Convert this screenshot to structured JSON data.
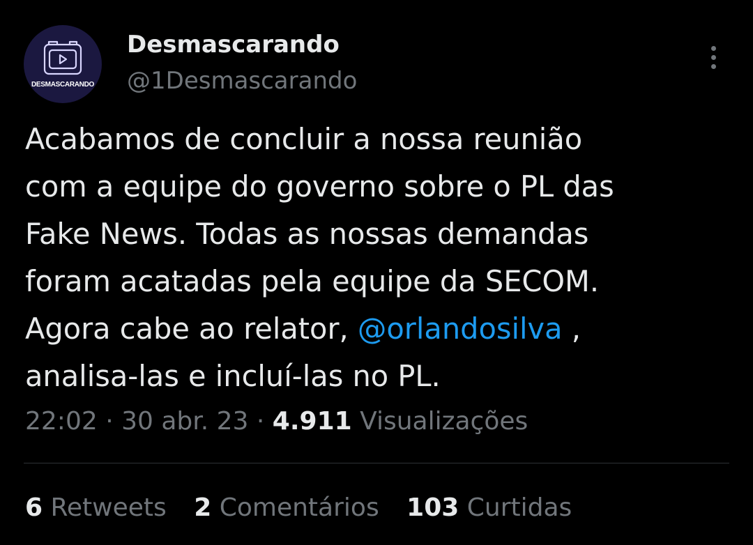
{
  "author": {
    "display_name": "Desmascarando",
    "handle": "@1Desmascarando",
    "avatar_label": "DESMASCARANDO",
    "avatar_icon": "video-screen-icon",
    "avatar_bg": "#1b1840"
  },
  "more_icon": "more-vertical-icon",
  "tweet": {
    "lines": [
      "Acabamos de concluir a nossa reunião",
      "com a equipe do governo sobre o PL das",
      "Fake News. Todas as nossas demandas",
      "foram acatadas pela equipe da SECOM.",
      "Agora cabe ao relator,",
      "analisa-las e incluí-las no PL."
    ],
    "mention": "@orlandosilva",
    "after_mention": " ,"
  },
  "meta": {
    "time": "22:02",
    "sep1": " · ",
    "date": "30 abr. 23",
    "sep2": " · ",
    "views_count": "4.911",
    "views_label": " Visualizações"
  },
  "stats": {
    "retweets_count": "6",
    "retweets_label": " Retweets",
    "comments_count": "2",
    "comments_label": " Comentários",
    "likes_count": "103",
    "likes_label": " Curtidas"
  },
  "colors": {
    "background": "#000000",
    "text": "#e7e9ea",
    "secondary": "#71767b",
    "link": "#1d9bf0",
    "divider": "#2f3336"
  }
}
